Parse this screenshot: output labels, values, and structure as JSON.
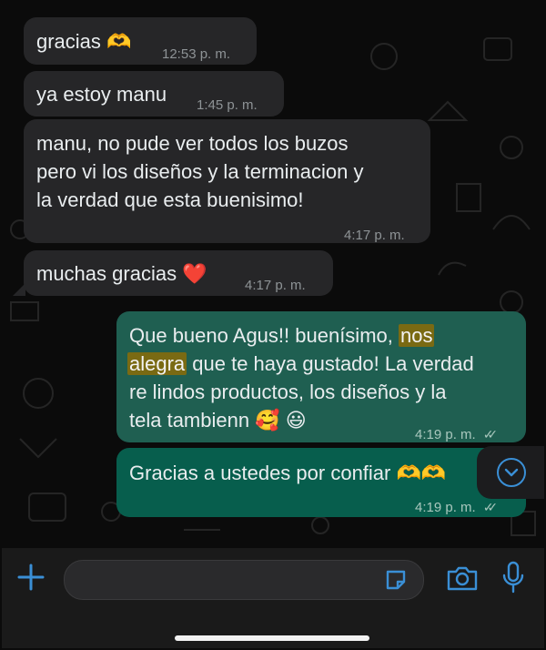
{
  "messages": [
    {
      "text": "gracias 🫶",
      "time": "12:53 p. m."
    },
    {
      "text": "ya estoy manu",
      "time": "1:45 p. m."
    },
    {
      "lines": [
        "manu, no pude ver todos los buzos",
        "pero vi los diseños y la terminacion y",
        "la verdad que esta buenisimo!"
      ],
      "time": "4:17 p. m."
    },
    {
      "text": "muchas gracias ❤️",
      "time": "4:17 p. m."
    },
    {
      "line1_pre": "Que bueno Agus!! buenísimo, ",
      "line1_hl": "nos",
      "line2_hl": "alegra",
      "line2_post": " que te haya gustado! La verdad",
      "line3": "re lindos productos, los diseños y la",
      "line4": "tela tambienn 🥰 😃",
      "time": "4:19 p. m."
    },
    {
      "text": "Gracias a ustedes por confiar 🫶🫶",
      "time": "4:19 p. m."
    }
  ],
  "icons": {
    "add": "plus-icon",
    "sticker": "sticker-icon",
    "camera": "camera-icon",
    "mic": "microphone-icon",
    "scroll": "chevron-down-icon"
  },
  "colors": {
    "incoming": "#262628",
    "outgoing": "#1f5f51",
    "accent": "#3a8fd6",
    "highlight": "#7a6a13"
  }
}
